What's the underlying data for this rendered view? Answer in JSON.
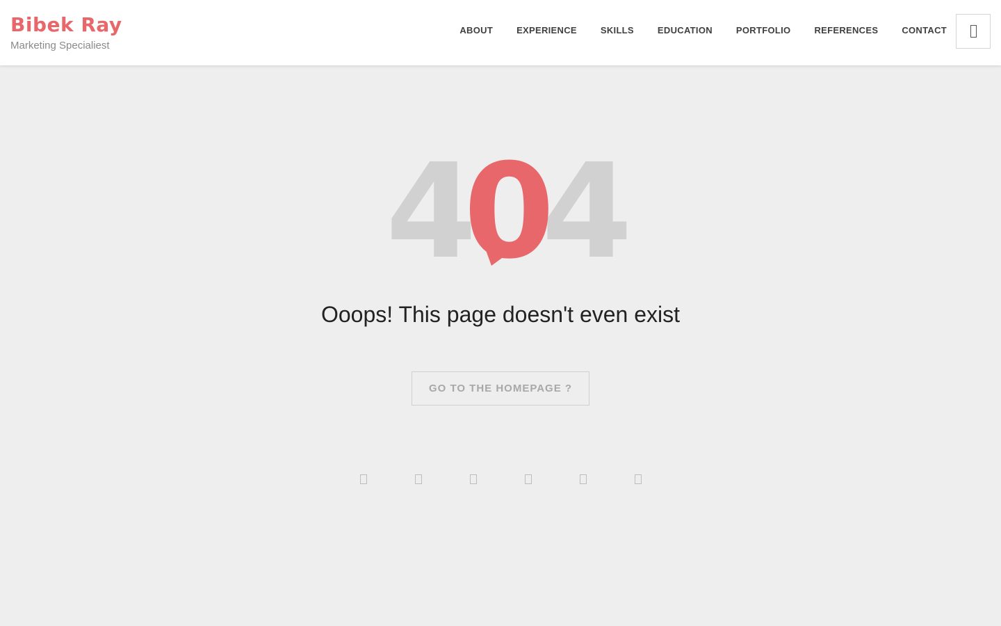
{
  "brand": {
    "name": "Bibek Ray",
    "tagline": "Marketing Specialiest",
    "color": "#e8676b"
  },
  "nav": {
    "items": [
      {
        "label": "ABOUT"
      },
      {
        "label": "EXPERIENCE"
      },
      {
        "label": "SKILLS"
      },
      {
        "label": "EDUCATION"
      },
      {
        "label": "PORTFOLIO"
      },
      {
        "label": "REFERENCES"
      },
      {
        "label": "CONTACT"
      }
    ],
    "menu_icon": "menu-icon"
  },
  "error": {
    "digit_1": "4",
    "digit_2": "0",
    "digit_3": "4",
    "message": "Ooops! This page doesn't even exist",
    "button_label": "GO TO THE HOMEPAGE ?",
    "digit_color": "#d1d1d1",
    "accent_color": "#e8676b"
  },
  "social": {
    "icons": [
      "social-icon-1",
      "social-icon-2",
      "social-icon-3",
      "social-icon-4",
      "social-icon-5",
      "social-icon-6"
    ]
  },
  "colors": {
    "background": "#eeeeee",
    "header_background": "#ffffff",
    "nav_text": "#3f3f3f",
    "muted_text": "#8a8a8a"
  }
}
